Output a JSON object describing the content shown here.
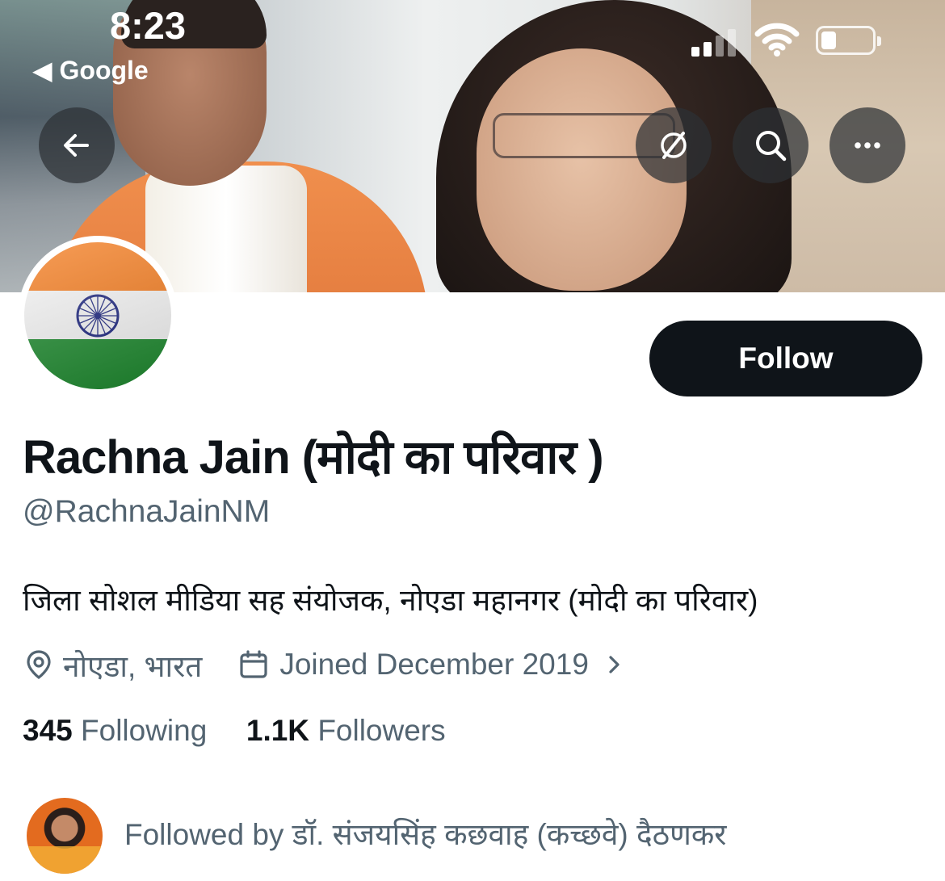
{
  "status_bar": {
    "time": "8:23",
    "back_app": "◀ Google"
  },
  "header_actions": {
    "back_icon": "arrow-left-icon",
    "grok_icon": "slash-circle-icon",
    "search_icon": "search-icon",
    "more_icon": "more-horizontal-icon"
  },
  "profile": {
    "follow_label": "Follow",
    "name": "Rachna Jain (मोदी का परिवार )",
    "handle": "@RachnaJainNM",
    "bio": "जिला सोशल मीडिया सह संयोजक, नोएडा महानगर (मोदी का परिवार)",
    "location": "नोएडा, भारत",
    "joined": "Joined December 2019",
    "following_count": "345",
    "following_label": "Following",
    "followers_count": "1.1K",
    "followers_label": "Followers",
    "followed_by": "Followed by डॉ. संजयसिंह कछवाह (कच्छवे) दैठणकर"
  },
  "colors": {
    "primary_text": "#0f1419",
    "secondary_text": "#536471",
    "follow_bg": "#0f1419"
  }
}
